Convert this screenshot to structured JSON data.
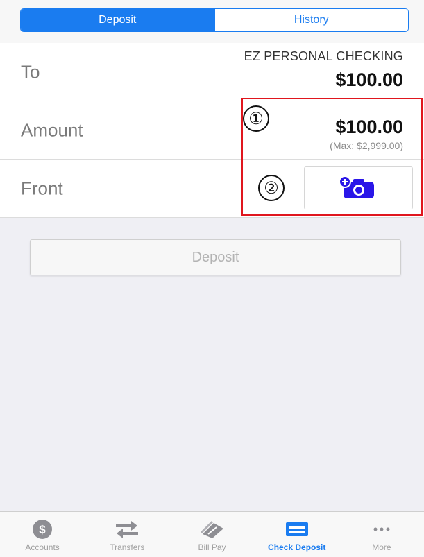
{
  "segmented": {
    "tabs": [
      {
        "label": "Deposit",
        "selected": true
      },
      {
        "label": "History",
        "selected": false
      }
    ]
  },
  "form": {
    "to": {
      "label": "To",
      "account": "EZ PERSONAL CHECKING",
      "balance": "$100.00"
    },
    "amount": {
      "label": "Amount",
      "value": "$100.00",
      "max": "(Max: $2,999.00)"
    },
    "front": {
      "label": "Front",
      "button_icon": "add-camera-icon"
    }
  },
  "annotations": {
    "one": "①",
    "two": "②"
  },
  "deposit_button": {
    "label": "Deposit",
    "enabled": false
  },
  "tabbar": {
    "items": [
      {
        "label": "Accounts",
        "icon": "dollar-icon",
        "active": false
      },
      {
        "label": "Transfers",
        "icon": "transfer-arrows-icon",
        "active": false
      },
      {
        "label": "Bill Pay",
        "icon": "bill-pay-icon",
        "active": false
      },
      {
        "label": "Check Deposit",
        "icon": "check-deposit-icon",
        "active": true
      },
      {
        "label": "More",
        "icon": "more-dots-icon",
        "active": false
      }
    ]
  },
  "colors": {
    "accent": "#1a7cf0",
    "camera": "#2a16e8",
    "annotation": "#e0161e"
  }
}
